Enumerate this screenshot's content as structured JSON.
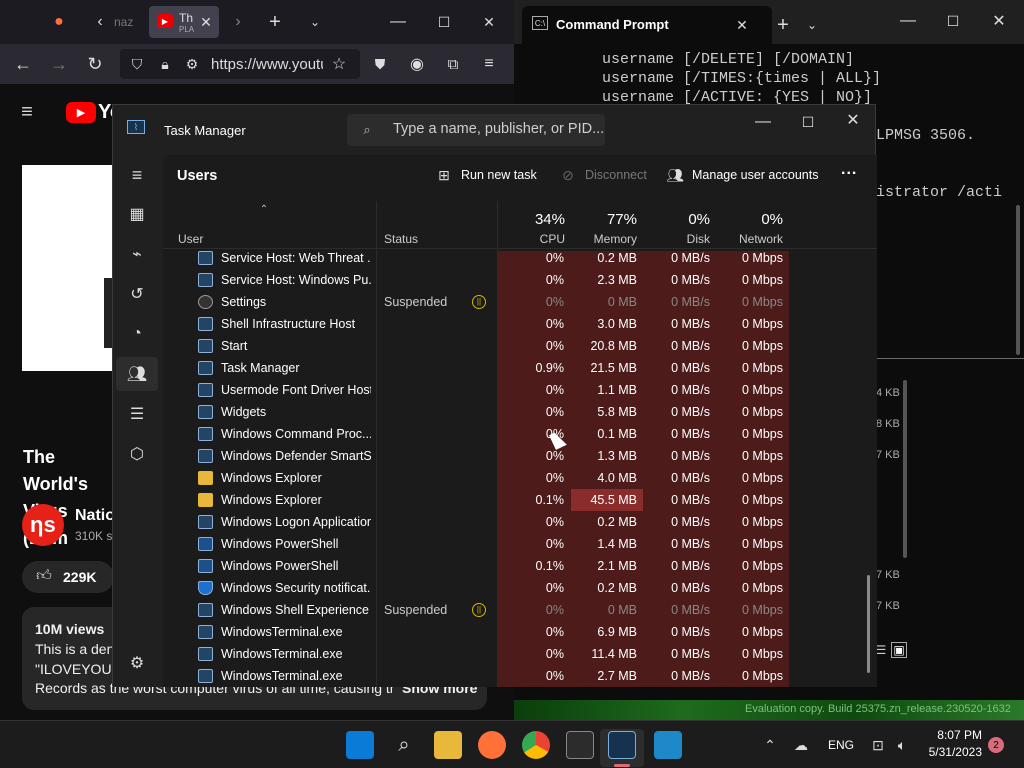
{
  "browser": {
    "tab_title_1": "naz",
    "tab_title_2": "Th",
    "tab_sub_2": "PLA",
    "url": "https://www.youtu",
    "video_title": "The World's Virus (Dem",
    "channel_name": "Natio",
    "channel_subs": "310K s",
    "likes": "229K",
    "views": "10M views",
    "desc_line1": "This is a den",
    "desc_line2": "\"ILOVEYOU\")",
    "desc_line3": "Records as the worst computer virus of all time, causing tr",
    "show_more": "Show more"
  },
  "cmd": {
    "tab_title": "Command Prompt",
    "lines": [
      "username [/DELETE] [/DOMAIN]",
      "username [/TIMES:{times | ALL}]",
      "username [/ACTIVE: {YES | NO}]"
    ],
    "line_frag1": "LPMSG 3506.",
    "line_frag2": "istrator /acti",
    "sizes": [
      "4 KB",
      "8 KB",
      "7 KB",
      "7 KB",
      "7 KB"
    ],
    "eval_text": "Evaluation copy. Build 25375.zn_release.230520-1632"
  },
  "taskmgr": {
    "title": "Task Manager",
    "search_placeholder": "Type a name, publisher, or PID...",
    "page_title": "Users",
    "run_new_task": "Run new task",
    "disconnect": "Disconnect",
    "manage_accounts": "Manage user accounts",
    "more": "...",
    "columns": {
      "user": "User",
      "status": "Status",
      "cpu_pct": "34%",
      "cpu": "CPU",
      "mem_pct": "77%",
      "memory": "Memory",
      "disk_pct": "0%",
      "disk": "Disk",
      "net_pct": "0%",
      "network": "Network"
    },
    "rows": [
      {
        "name": "Service Host: Web Threat ...",
        "status": "",
        "cpu": "0%",
        "mem": "0.2 MB",
        "disk": "0 MB/s",
        "net": "0 Mbps"
      },
      {
        "name": "Service Host: Windows Pu...",
        "status": "",
        "cpu": "0%",
        "mem": "2.3 MB",
        "disk": "0 MB/s",
        "net": "0 Mbps"
      },
      {
        "name": "Settings",
        "status": "Suspended",
        "cpu": "0%",
        "mem": "0 MB",
        "disk": "0 MB/s",
        "net": "0 Mbps"
      },
      {
        "name": "Shell Infrastructure Host",
        "status": "",
        "cpu": "0%",
        "mem": "3.0 MB",
        "disk": "0 MB/s",
        "net": "0 Mbps"
      },
      {
        "name": "Start",
        "status": "",
        "cpu": "0%",
        "mem": "20.8 MB",
        "disk": "0 MB/s",
        "net": "0 Mbps"
      },
      {
        "name": "Task Manager",
        "status": "",
        "cpu": "0.9%",
        "mem": "21.5 MB",
        "disk": "0 MB/s",
        "net": "0 Mbps"
      },
      {
        "name": "Usermode Font Driver Host",
        "status": "",
        "cpu": "0%",
        "mem": "1.1 MB",
        "disk": "0 MB/s",
        "net": "0 Mbps"
      },
      {
        "name": "Widgets",
        "status": "",
        "cpu": "0%",
        "mem": "5.8 MB",
        "disk": "0 MB/s",
        "net": "0 Mbps"
      },
      {
        "name": "Windows Command Proc...",
        "status": "",
        "cpu": "0%",
        "mem": "0.1 MB",
        "disk": "0 MB/s",
        "net": "0 Mbps"
      },
      {
        "name": "Windows Defender SmartS...",
        "status": "",
        "cpu": "0%",
        "mem": "1.3 MB",
        "disk": "0 MB/s",
        "net": "0 Mbps"
      },
      {
        "name": "Windows Explorer",
        "status": "",
        "cpu": "0%",
        "mem": "4.0 MB",
        "disk": "0 MB/s",
        "net": "0 Mbps"
      },
      {
        "name": "Windows Explorer",
        "status": "",
        "cpu": "0.1%",
        "mem": "45.5 MB",
        "disk": "0 MB/s",
        "net": "0 Mbps"
      },
      {
        "name": "Windows Logon Application",
        "status": "",
        "cpu": "0%",
        "mem": "0.2 MB",
        "disk": "0 MB/s",
        "net": "0 Mbps"
      },
      {
        "name": "Windows PowerShell",
        "status": "",
        "cpu": "0%",
        "mem": "1.4 MB",
        "disk": "0 MB/s",
        "net": "0 Mbps"
      },
      {
        "name": "Windows PowerShell",
        "status": "",
        "cpu": "0.1%",
        "mem": "2.1 MB",
        "disk": "0 MB/s",
        "net": "0 Mbps"
      },
      {
        "name": "Windows Security notificat...",
        "status": "",
        "cpu": "0%",
        "mem": "0.2 MB",
        "disk": "0 MB/s",
        "net": "0 Mbps"
      },
      {
        "name": "Windows Shell Experience ...",
        "status": "Suspended",
        "cpu": "0%",
        "mem": "0 MB",
        "disk": "0 MB/s",
        "net": "0 Mbps"
      },
      {
        "name": "WindowsTerminal.exe",
        "status": "",
        "cpu": "0%",
        "mem": "6.9 MB",
        "disk": "0 MB/s",
        "net": "0 Mbps"
      },
      {
        "name": "WindowsTerminal.exe",
        "status": "",
        "cpu": "0%",
        "mem": "11.4 MB",
        "disk": "0 MB/s",
        "net": "0 Mbps"
      },
      {
        "name": "WindowsTerminal.exe",
        "status": "",
        "cpu": "0%",
        "mem": "2.7 MB",
        "disk": "0 MB/s",
        "net": "0 Mbps"
      }
    ]
  },
  "taskbar": {
    "lang": "ENG",
    "time": "8:07 PM",
    "date": "5/31/2023",
    "notif_count": "2"
  }
}
